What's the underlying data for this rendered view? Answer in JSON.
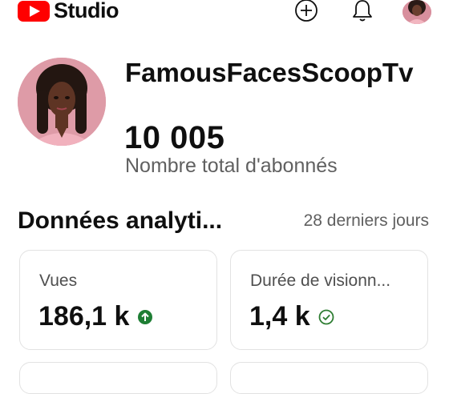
{
  "app": {
    "name": "Studio",
    "brand_color": "#ff0000"
  },
  "header_icons": [
    "add-circle-icon",
    "bell-icon",
    "account-avatar"
  ],
  "channel": {
    "name": "FamousFacesScoopTv",
    "subscribers": "10 005",
    "subscribers_label": "Nombre total d'abonnés"
  },
  "analytics": {
    "title": "Données analyti...",
    "range": "28 derniers jours",
    "cards": [
      {
        "label": "Vues",
        "value": "186,1 k",
        "status_icon": "arrow-up-circle-icon",
        "status_color": "#1e7e34"
      },
      {
        "label": "Durée de visionn...",
        "value": "1,4 k",
        "status_icon": "check-circle-icon",
        "status_color": "#2e7d32"
      }
    ]
  }
}
